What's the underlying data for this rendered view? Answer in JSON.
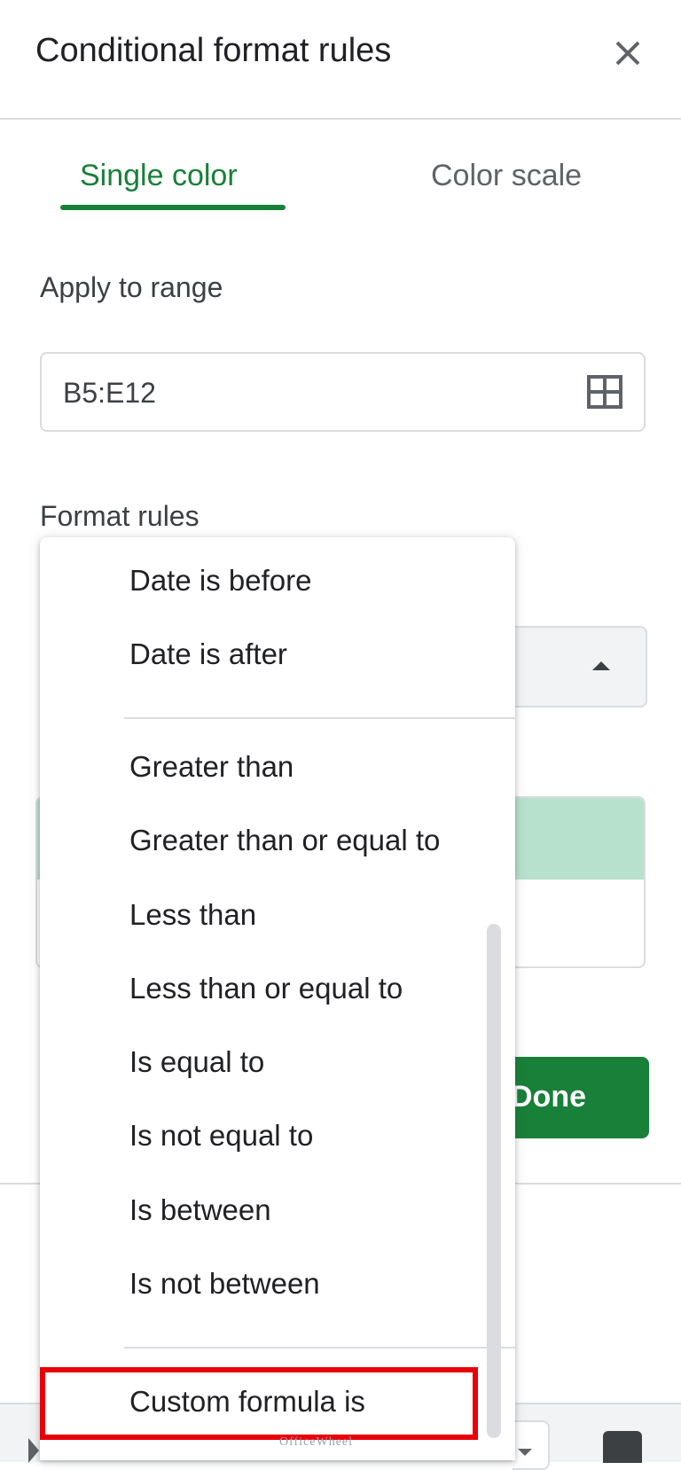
{
  "header": {
    "title": "Conditional format rules",
    "close_icon": "close-icon"
  },
  "tabs": [
    {
      "label": "Single color",
      "active": true
    },
    {
      "label": "Color scale",
      "active": false
    }
  ],
  "apply_range": {
    "label": "Apply to range",
    "value": "B5:E12",
    "icon": "grid-select-icon"
  },
  "format_rules": {
    "label": "Format rules"
  },
  "done_button": {
    "label": "Done"
  },
  "menu": {
    "items_top": [
      "Date is before",
      "Date is after"
    ],
    "items_middle": [
      "Greater than",
      "Greater than or equal to",
      "Less than",
      "Less than or equal to",
      "Is equal to",
      "Is not equal to",
      "Is between",
      "Is not between"
    ],
    "selected": "Custom formula is"
  },
  "watermark": "OfficeWheel",
  "colors": {
    "accent": "#188038",
    "highlight": "#e8000b",
    "preview": "#b7e1cd"
  }
}
